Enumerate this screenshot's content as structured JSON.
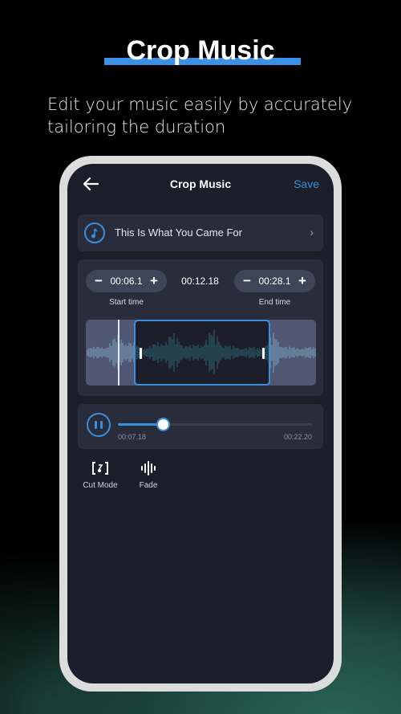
{
  "promo": {
    "title": "Crop Music",
    "subtitle": "Edit your music easily by accurately tailoring the duration",
    "accent": "#3b91e6"
  },
  "app": {
    "header": {
      "back_icon": "arrow-left-icon",
      "title": "Crop Music",
      "save_label": "Save"
    },
    "song": {
      "icon": "music-note-icon",
      "name": "This Is What You Came For",
      "chevron_icon": "chevron-right-icon"
    },
    "editor": {
      "start": {
        "minus_label": "−",
        "value": "00:06.1",
        "plus_label": "+",
        "label": "Start time"
      },
      "duration": "00:12.18",
      "end": {
        "minus_label": "−",
        "value": "00:28.1",
        "plus_label": "+",
        "label": "End time"
      },
      "selection_fraction": {
        "start": 0.21,
        "end": 0.8
      },
      "playhead_fraction": 0.14
    },
    "player": {
      "state_icon": "pause-icon",
      "current_time": "00:07.18",
      "total_time": "00:22.20",
      "progress_fraction": 0.23
    },
    "tools": [
      {
        "icon": "cut-mode-icon",
        "label": "Cut Mode"
      },
      {
        "icon": "fade-icon",
        "label": "Fade"
      }
    ],
    "colors": {
      "accent": "#3a8fdc",
      "screen_bg": "#1c1e29",
      "card_bg": "#282c3b"
    }
  }
}
